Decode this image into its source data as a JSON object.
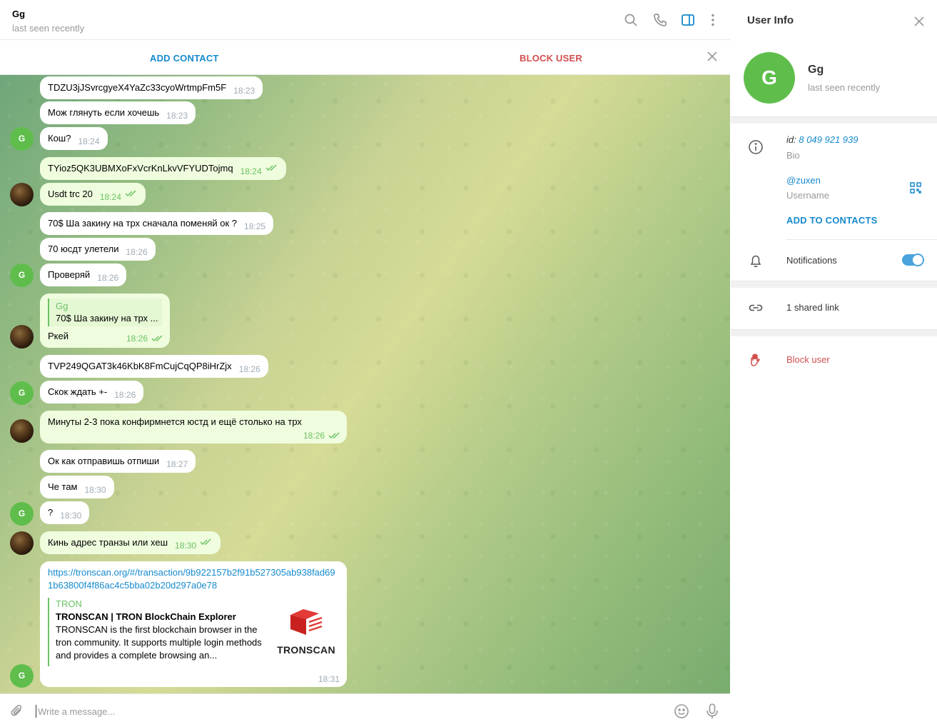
{
  "chat": {
    "title": "Gg",
    "status": "last seen recently",
    "add_contact": "ADD CONTACT",
    "block_user": "BLOCK USER"
  },
  "messages": [
    {
      "text": "TDZU3jJSvrcgyeX4YaZc33cyoWrtmpFm5F",
      "time": "18:23",
      "out": false
    },
    {
      "text": "Мож глянуть если хочешь",
      "time": "18:23",
      "out": false
    },
    {
      "text": "Кош?",
      "time": "18:24",
      "out": false
    },
    {
      "text": "TYioz5QK3UBMXoFxVcrKnLkvVFYUDTojmq",
      "time": "18:24",
      "out": true
    },
    {
      "text": "Usdt trc 20",
      "time": "18:24",
      "out": true
    },
    {
      "text": "70$ Ша закину на трх сначала поменяй ок ?",
      "time": "18:25",
      "out": false
    },
    {
      "text": "70 юсдт улетели",
      "time": "18:26",
      "out": false
    },
    {
      "text": "Проверяй",
      "time": "18:26",
      "out": false
    },
    {
      "text": "Ркей",
      "time": "18:26",
      "out": true,
      "reply_name": "Gg",
      "reply_text": "70$ Ша закину на трх ..."
    },
    {
      "text": "TVP249QGAT3k46KbK8FmCujCqQP8iHrZjx",
      "time": "18:26",
      "out": false
    },
    {
      "text": "Скок ждать +-",
      "time": "18:26",
      "out": false
    },
    {
      "text": "Минуты 2-3 пока конфирмнется юстд и ещё столько на трх",
      "time": "18:26",
      "out": true
    },
    {
      "text": "Ок как отправишь отпиши",
      "time": "18:27",
      "out": false
    },
    {
      "text": "Че там",
      "time": "18:30",
      "out": false
    },
    {
      "text": "?",
      "time": "18:30",
      "out": false
    },
    {
      "text": "Кинь адрес транзы или хеш",
      "time": "18:30",
      "out": true
    },
    {
      "link": "https://tronscan.org/#/transaction/9b922157b2f91b527305ab938fad691b63800f4f86ac4c5bba02b20d297a0e78",
      "time": "18:31",
      "out": false,
      "preview_site": "TRON",
      "preview_title": "TRONSCAN | TRON BlockChain Explorer",
      "preview_desc": "TRONSCAN is the first blockchain browser in the tron community. It supports multiple login methods and provides a complete browsing an...",
      "preview_thumb_label": "TRONSCAN"
    }
  ],
  "avatars": {
    "initial": "G"
  },
  "composer": {
    "placeholder": "Write a message..."
  },
  "info": {
    "title": "User Info",
    "name": "Gg",
    "status": "last seen recently",
    "avatar_initial": "G",
    "id_prefix": "id:",
    "id_value": "8 049 921 939",
    "bio_label": "Bio",
    "username": "@zuxen",
    "username_label": "Username",
    "add_to_contacts": "ADD TO CONTACTS",
    "notifications_label": "Notifications",
    "notifications_on": true,
    "shared_links": "1 shared link",
    "block_user": "Block user"
  },
  "colors": {
    "accent": "#168acd",
    "danger": "#d14e4e",
    "green": "#5fbe4b",
    "out_bubble": "#effdde"
  }
}
